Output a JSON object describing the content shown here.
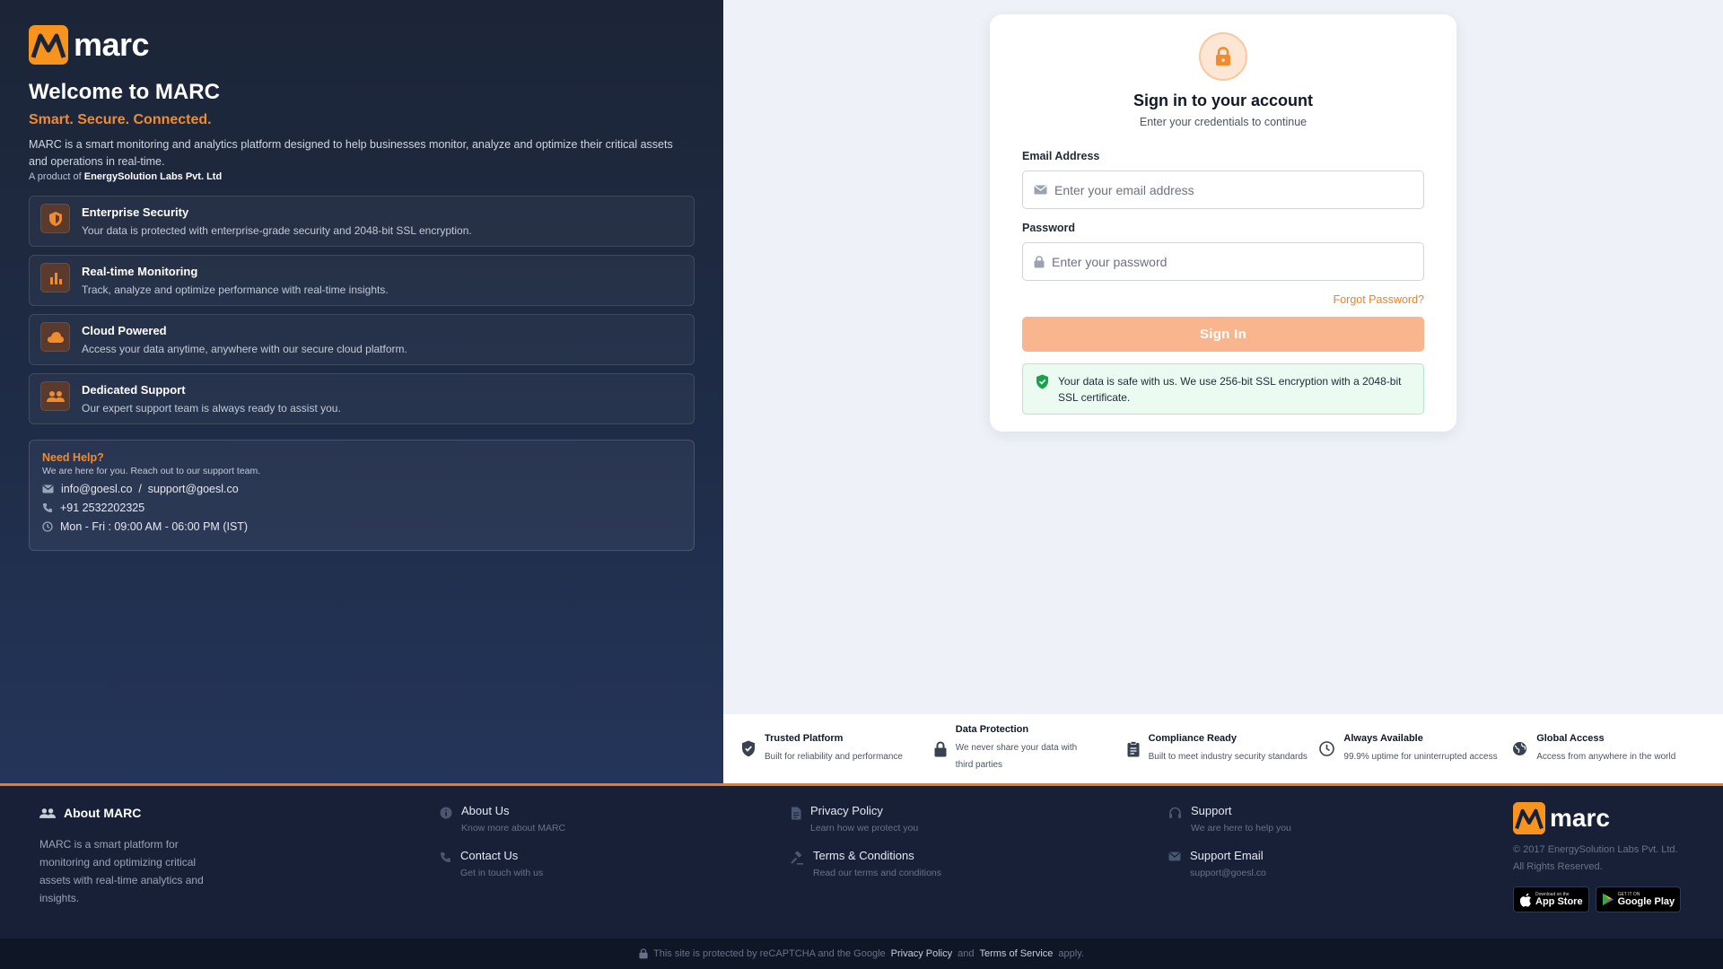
{
  "brand": {
    "name": "marc",
    "accent": "#f28a2e"
  },
  "left": {
    "welcome": "Welcome to MARC",
    "tagline": "Smart. Secure. Connected.",
    "description": "MARC is a smart monitoring and analytics platform designed to help businesses monitor, analyze and optimize their critical assets and operations in real-time.",
    "product_prefix": "A product of",
    "product_company": "EnergySolution Labs Pvt. Ltd",
    "features": [
      {
        "title": "Enterprise Security",
        "desc": "Your data is protected with enterprise-grade security and 2048-bit SSL encryption.",
        "icon": "shield-icon"
      },
      {
        "title": "Real-time Monitoring",
        "desc": "Track, analyze and optimize performance with real-time insights.",
        "icon": "bar-chart-icon"
      },
      {
        "title": "Cloud Powered",
        "desc": "Access your data anytime, anywhere with our secure cloud platform.",
        "icon": "cloud-icon"
      },
      {
        "title": "Dedicated Support",
        "desc": "Our expert support team is always ready to assist you.",
        "icon": "people-icon"
      }
    ],
    "help": {
      "title": "Need Help?",
      "sub": "We are here for you. Reach out to our support team.",
      "emails": "info@goesl.co  /  support@goesl.co",
      "phone": "+91 2532202325",
      "hours": "Mon - Fri : 09:00 AM - 06:00 PM (IST)"
    }
  },
  "login": {
    "title": "Sign in to your account",
    "subtitle": "Enter your credentials to continue",
    "email_label": "Email Address",
    "email_placeholder": "Enter your email address",
    "password_label": "Password",
    "password_placeholder": "Enter your password",
    "forgot": "Forgot Password?",
    "signin": "Sign In",
    "safe_note": "Your data is safe with us. We use 256-bit SSL encryption with a 2048-bit SSL certificate."
  },
  "trust": [
    {
      "title": "Trusted Platform",
      "desc": "Built for reliability and performance",
      "icon": "verified-shield-icon"
    },
    {
      "title": "Data Protection",
      "desc": "We never share your data with third parties",
      "icon": "lock-icon"
    },
    {
      "title": "Compliance Ready",
      "desc": "Built to meet industry security standards",
      "icon": "clipboard-icon"
    },
    {
      "title": "Always Available",
      "desc": "99.9% uptime for uninterrupted access",
      "icon": "clock-icon"
    },
    {
      "title": "Global Access",
      "desc": "Access from anywhere in the world",
      "icon": "globe-icon"
    }
  ],
  "footer": {
    "about_title": "About MARC",
    "about_text": "MARC is a smart platform for monitoring and optimizing critical assets with real-time analytics and insights.",
    "links": [
      {
        "title": "About Us",
        "desc": "Know more about MARC",
        "icon": "info-icon"
      },
      {
        "title": "Contact Us",
        "desc": "Get in touch with us",
        "icon": "phone-icon"
      },
      {
        "title": "Privacy Policy",
        "desc": "Learn how we protect you",
        "icon": "document-icon"
      },
      {
        "title": "Terms & Conditions",
        "desc": "Read our terms and conditions",
        "icon": "gavel-icon"
      },
      {
        "title": "Support",
        "desc": "We are here to help you",
        "icon": "headset-icon"
      },
      {
        "title": "Support Email",
        "desc": "support@goesl.co",
        "icon": "mail-icon"
      }
    ],
    "copyright": "© 2017 EnergySolution Labs Pvt. Ltd.",
    "rights": "All Rights Reserved.",
    "appstore_small": "Download on the",
    "appstore_big": "App Store",
    "googleplay_small": "GET IT ON",
    "googleplay_big": "Google Play"
  },
  "bottom": {
    "text1": "This site is protected by reCAPTCHA and the Google",
    "privacy": "Privacy Policy",
    "and": "and",
    "terms": "Terms of Service",
    "apply": "apply."
  }
}
